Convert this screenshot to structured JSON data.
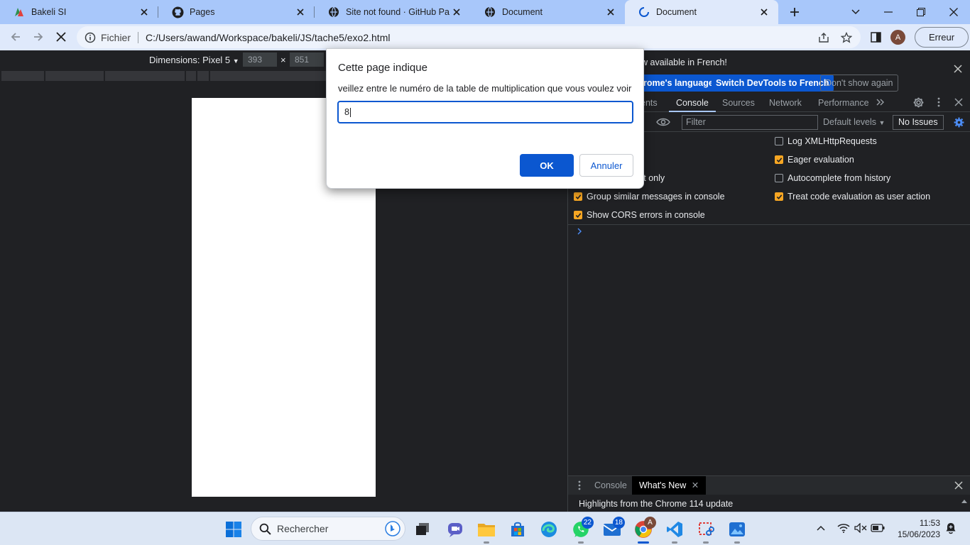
{
  "tabs": [
    {
      "title": "Bakeli SI",
      "icon": "bakeli-logo-icon"
    },
    {
      "title": "Pages",
      "icon": "github-icon"
    },
    {
      "title": "Site not found · GitHub Pages",
      "icon": "globe-icon"
    },
    {
      "title": "Document",
      "icon": "globe-icon"
    },
    {
      "title": "Document",
      "icon": "loading-spinner-icon"
    }
  ],
  "address_bar": {
    "site_label": "Fichier",
    "url": "C:/Users/awand/Workspace/bakeli/JS/tache5/exo2.html"
  },
  "profile": {
    "initial": "A"
  },
  "error_button": "Erreur",
  "device_toolbar": {
    "dimensions_label": "Dimensions: Pixel 5",
    "width": "393",
    "x_sep": "×",
    "height": "851"
  },
  "devtools": {
    "infobar": {
      "message": "w available in French!",
      "btn_language": "rome's language",
      "btn_switch": "Switch DevTools to French",
      "btn_dont_show": "Don't show again"
    },
    "tabs": [
      "ents",
      "Console",
      "Sources",
      "Network",
      "Performance"
    ],
    "active_tab": "Console",
    "filter_placeholder": "Filter",
    "levels": "Default levels",
    "issues": "No Issues",
    "settings": {
      "log_xhr": "Log XMLHttpRequests",
      "eager_eval": "Eager evaluation",
      "context_only": "xt only",
      "autocomplete": "Autocomplete from history",
      "group_similar": "Group similar messages in console",
      "treat_eval": "Treat code evaluation as user action",
      "cors_errors": "Show CORS errors in console"
    },
    "drawer": {
      "tab_console": "Console",
      "tab_whats_new": "What's New",
      "content": "Highlights from the Chrome 114 update"
    }
  },
  "dialog": {
    "title": "Cette page indique",
    "message": "veillez entre le numéro de la table de multiplication que vous voulez voir",
    "input_value": "8",
    "ok": "OK",
    "cancel": "Annuler"
  },
  "taskbar": {
    "search_placeholder": "Rechercher",
    "teams_badge": "22",
    "mail_badge": "18",
    "chrome_badge": "A",
    "time": "11:53",
    "date": "15/06/2023"
  },
  "colors": {
    "accent": "#0b57d0",
    "tab_strip": "#a8c7fa",
    "devtools_bg": "#202124",
    "checkbox_on": "#f6a623"
  }
}
